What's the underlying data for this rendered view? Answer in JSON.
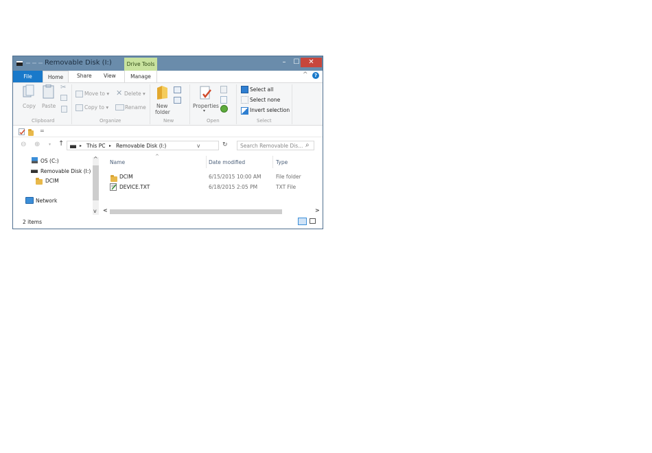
{
  "window": {
    "title": "Removable Disk (I:)",
    "context_tab": "Drive Tools",
    "controls": {
      "minimize": "–",
      "maximize": "☐",
      "close": "✕"
    }
  },
  "ribbon_tabs": [
    "File",
    "Home",
    "Share",
    "View",
    "Manage"
  ],
  "ribbon": {
    "clipboard": {
      "copy": "Copy",
      "paste": "Paste",
      "group": "Clipboard"
    },
    "organize": {
      "move_to": "Move to ▾",
      "copy_to": "Copy to ▾",
      "delete": "Delete ▾",
      "rename": "Rename",
      "group": "Organize"
    },
    "new": {
      "new_folder_line1": "New",
      "new_folder_line2": "folder",
      "group": "New"
    },
    "open": {
      "properties": "Properties",
      "properties_arrow": "▾",
      "group": "Open"
    },
    "select": {
      "select_all": "Select all",
      "select_none": "Select none",
      "invert_selection": "Invert selection",
      "group": "Select"
    },
    "collapse": "^",
    "help": "?"
  },
  "qat": {
    "dropdown": "="
  },
  "nav": {
    "back": "⊖",
    "forward": "⊕",
    "recent": "▾",
    "up": "↑",
    "breadcrumb": [
      "This PC",
      "Removable Disk (I:)"
    ],
    "separator": "▸",
    "address_dropdown": "v",
    "refresh": "↻",
    "search_placeholder": "Search Removable Dis...",
    "search_icon": "⌕"
  },
  "tree": [
    {
      "label": "OS (C:)",
      "icon": "os-drive-icon"
    },
    {
      "label": "Removable Disk (I:)",
      "icon": "removable-drive-icon",
      "selected": true
    },
    {
      "label": "DCIM",
      "icon": "folder-icon"
    },
    {
      "label": "Network",
      "icon": "network-icon"
    }
  ],
  "scroll": {
    "up": "^",
    "down": "v",
    "left": "<",
    "right": ">"
  },
  "columns": {
    "name": "Name",
    "date_modified": "Date modified",
    "type": "Type",
    "sort_indicator": "^"
  },
  "files": [
    {
      "name": "DCIM",
      "date": "6/15/2015 10:00 AM",
      "type": "File folder",
      "icon": "folder-icon"
    },
    {
      "name": "DEVICE.TXT",
      "date": "6/18/2015 2:05 PM",
      "type": "TXT File",
      "icon": "text-file-icon"
    }
  ],
  "status": {
    "item_count": "2 items"
  },
  "colors": {
    "titlebar": "#6a8cab",
    "file_tab": "#1979ca",
    "drive_tools": "#c8e29e",
    "close": "#c7463c"
  }
}
